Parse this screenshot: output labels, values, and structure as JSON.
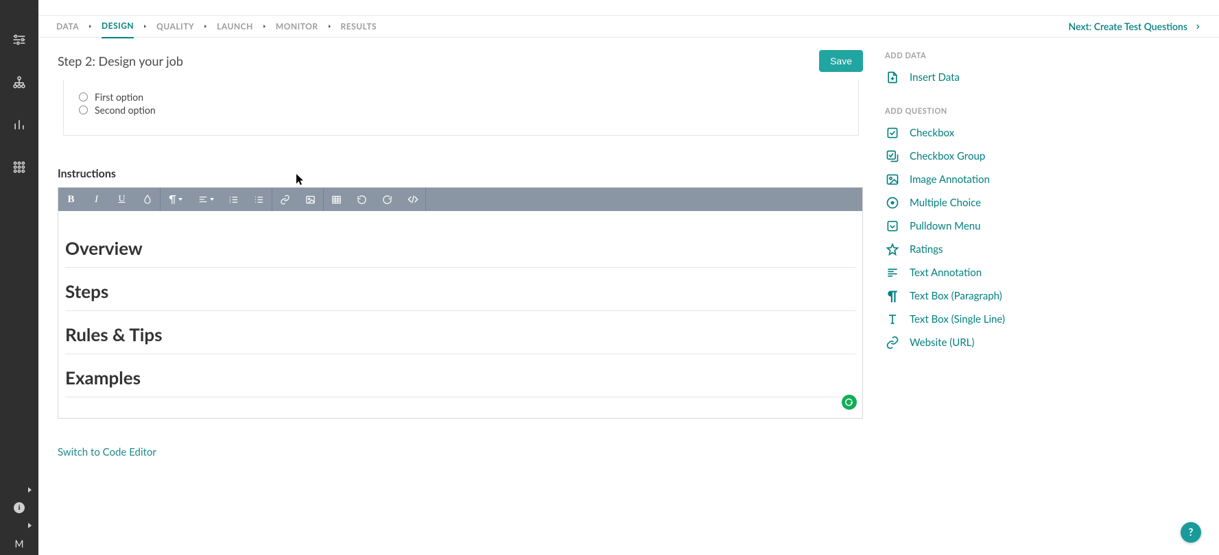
{
  "tabs": {
    "data": "DATA",
    "design": "DESIGN",
    "quality": "QUALITY",
    "launch": "LAUNCH",
    "monitor": "MONITOR",
    "results": "RESULTS"
  },
  "next_link": "Next: Create Test Questions",
  "page_title": "Step 2: Design your job",
  "save_label": "Save",
  "radio": {
    "opt1": "First option",
    "opt2": "Second option"
  },
  "instructions_label": "Instructions",
  "editor_sections": {
    "overview": "Overview",
    "steps": "Steps",
    "rules": "Rules & Tips",
    "examples": "Examples"
  },
  "switch_editor": "Switch to Code Editor",
  "right": {
    "add_data": "ADD DATA",
    "insert_data": "Insert Data",
    "add_question": "ADD QUESTION",
    "checkbox": "Checkbox",
    "checkbox_group": "Checkbox Group",
    "image_annotation": "Image Annotation",
    "multiple_choice": "Multiple Choice",
    "pulldown": "Pulldown Menu",
    "ratings": "Ratings",
    "text_annotation": "Text Annotation",
    "text_paragraph": "Text Box (Paragraph)",
    "text_single": "Text Box (Single Line)",
    "website": "Website (URL)"
  },
  "leftnav": {
    "avatar": "M"
  },
  "help": "?"
}
